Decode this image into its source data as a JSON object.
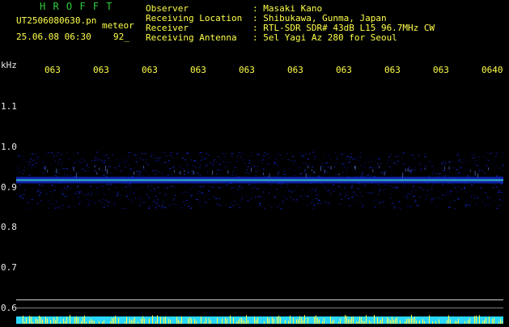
{
  "header": {
    "brand": "H R O F F T",
    "filename": "UT2506080630.pn",
    "meteor_label": "meteor",
    "datetime": "25.06.08 06:30",
    "count": "92_",
    "fields": [
      {
        "key": "Observer",
        "value": ": Masaki Kano"
      },
      {
        "key": "Receiving Location",
        "value": ": Shibukawa, Gunma, Japan"
      },
      {
        "key": "Receiver",
        "value": ": RTL-SDR SDR# 43dB L15 96.7MHz CW"
      },
      {
        "key": "Receiving Antenna",
        "value": ": 5el Yagi Az 280 for Seoul"
      }
    ]
  },
  "time_axis": {
    "labels": [
      "063",
      "063",
      "063",
      "063",
      "063",
      "063",
      "063",
      "063",
      "063",
      "0640"
    ]
  },
  "freq_axis": {
    "unit": "kHz",
    "labels": [
      "1.1",
      "1.0",
      "0.9",
      "0.8",
      "0.7",
      "0.6"
    ]
  },
  "spectrogram": {
    "signal_freq_khz": 0.89,
    "range_khz": [
      0.6,
      1.15
    ],
    "colors": {
      "signal": "#3cf0c8",
      "band": "#1428c8",
      "noise": "#0a0a60",
      "bottom_fill": "#2ad8ff",
      "bottom_peaks": "#ffff40"
    }
  }
}
